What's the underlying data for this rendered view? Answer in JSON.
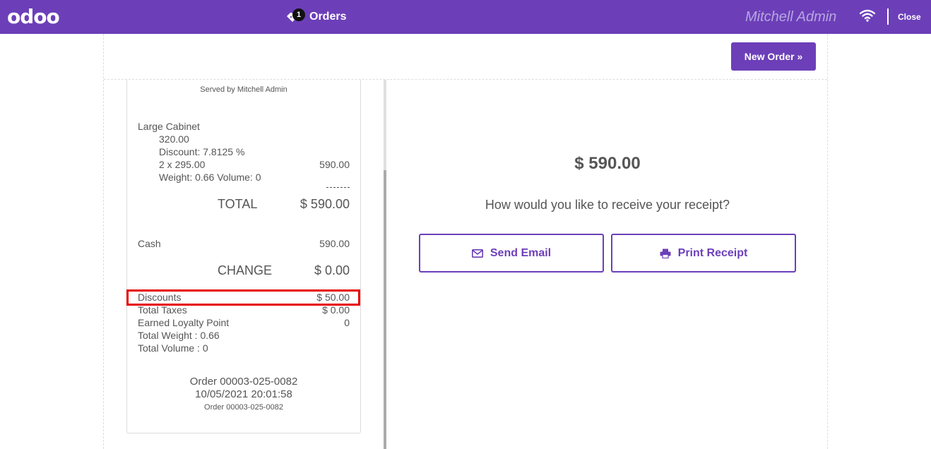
{
  "header": {
    "logo": "odoo",
    "orders_label": "Orders",
    "orders_badge": "1",
    "user": "Mitchell Admin",
    "close_label": "Close"
  },
  "toolbar": {
    "new_order_label": "New Order »"
  },
  "receipt": {
    "served_by": "Served by Mitchell Admin",
    "product": {
      "name": "Large Cabinet",
      "unit_price": "320.00",
      "discount": "Discount: 7.8125 %",
      "qty_price": "2 x 295.00",
      "line_total": "590.00",
      "weight_volume": "Weight: 0.66 Volume: 0"
    },
    "separator": "--------",
    "total_label": "TOTAL",
    "total_value": "$ 590.00",
    "payment_method": "Cash",
    "payment_amount": "590.00",
    "change_label": "CHANGE",
    "change_value": "$ 0.00",
    "discounts_label": "Discounts",
    "discounts_value": "$ 50.00",
    "taxes_label": "Total Taxes",
    "taxes_value": "$ 0.00",
    "loyalty_label": "Earned Loyalty Point",
    "loyalty_value": "0",
    "total_weight": "Total Weight : 0.66",
    "total_volume": "Total Volume : 0",
    "order_ref": "Order 00003-025-0082",
    "order_datetime": "10/05/2021 20:01:58",
    "order_ref_small": "Order 00003-025-0082"
  },
  "summary": {
    "amount": "$ 590.00",
    "question": "How would you like to receive your receipt?",
    "send_email_label": "Send Email",
    "print_receipt_label": "Print Receipt"
  },
  "colors": {
    "brand": "#6c3fb9",
    "highlight": "#e60000"
  }
}
